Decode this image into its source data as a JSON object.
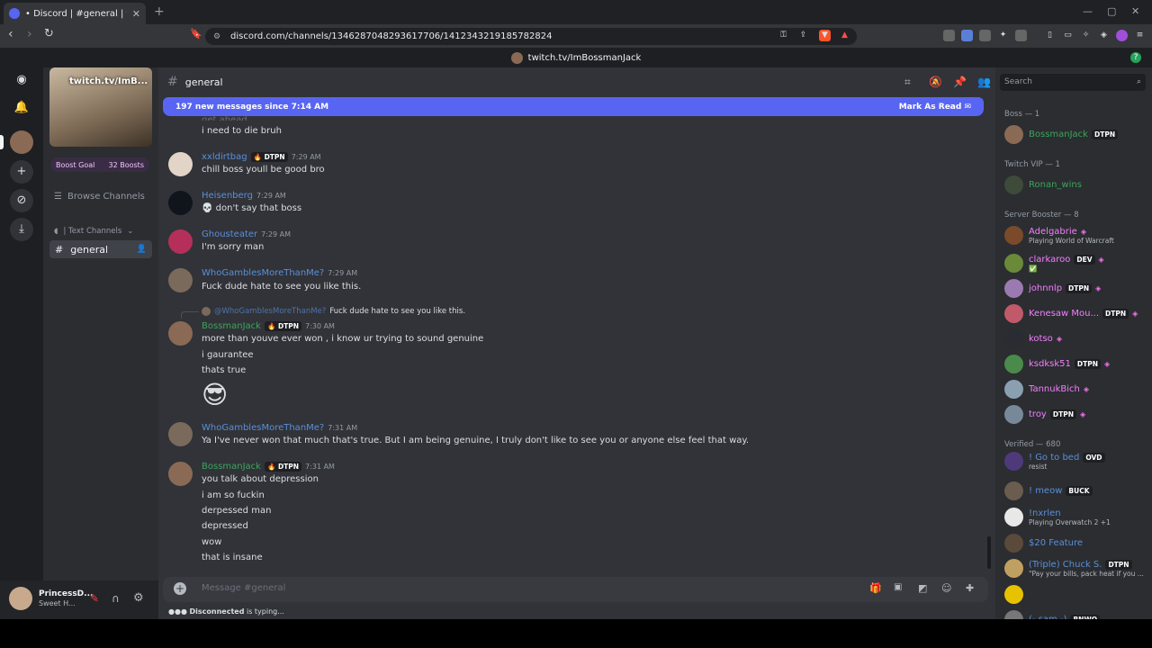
{
  "browser": {
    "tab_title": "• Discord | #general | twitch.tv/Im",
    "tab_close": "✕",
    "new_tab": "+",
    "url": "discord.com/channels/1346287048293617706/1412343219185782824"
  },
  "app": {
    "server_title": "twitch.tv/ImBossmanJack",
    "help": "?"
  },
  "sidebar": {
    "server_name": "twitch.tv/ImB...",
    "boost_goal": "Boost Goal",
    "boost_count": "32 Boosts",
    "browse_channels": "Browse Channels",
    "text_channels": "| Text Channels",
    "channel": "general"
  },
  "user_panel": {
    "name": "PrincessD...",
    "status": "Sweet H..."
  },
  "chat": {
    "channel_name": "general",
    "new_messages": "197 new messages since 7:14 AM",
    "mark_as_read": "Mark As Read",
    "partial_line": "get ahead",
    "composer_placeholder": "Message #general",
    "typing_user": "Disconnected",
    "typing_suffix": "is typing...",
    "messages": [
      {
        "lines": [
          "i need to die bruh"
        ]
      },
      {
        "user": "xxldirtbag",
        "badge": "DTPN",
        "time": "7:29 AM",
        "lines": [
          "chill boss youll be good bro"
        ]
      },
      {
        "user": "Heisenberg",
        "time": "7:29 AM",
        "lines": [
          "don't say that boss"
        ]
      },
      {
        "user": "Ghousteater",
        "time": "7:29 AM",
        "lines": [
          "I'm sorry man"
        ]
      },
      {
        "user": "WhoGamblesMoreThanMe?",
        "time": "7:29 AM",
        "lines": [
          "Fuck dude hate to see you like this."
        ]
      },
      {
        "reply_user": "@WhoGamblesMoreThanMe?",
        "reply_text": "Fuck dude hate to see you like this.",
        "user": "BossmanJack",
        "badge": "DTPN",
        "time": "7:30 AM",
        "lines": [
          "more than youve ever won , i know ur trying to sound genuine",
          "i gaurantee",
          "thats true"
        ],
        "emoji": "😎"
      },
      {
        "user": "WhoGamblesMoreThanMe?",
        "time": "7:31 AM",
        "lines": [
          "Ya I've never won that much that's true. But I am being genuine, I truly don't like to see you or anyone else feel that way."
        ]
      },
      {
        "user": "BossmanJack",
        "badge": "DTPN",
        "time": "7:31 AM",
        "lines": [
          "you talk about depression",
          "i am so fuckin",
          "derpessed man",
          "depressed",
          "wow",
          "that is insane"
        ]
      }
    ]
  },
  "members": {
    "search_placeholder": "Search",
    "groups": [
      {
        "label": "Boss — 1",
        "members": [
          {
            "name": "BossmanJack",
            "badge": "DTPN",
            "color": "#3ba55c"
          }
        ]
      },
      {
        "label": "Twitch VIP — 1",
        "members": [
          {
            "name": "Ronan_wins",
            "color": "#3ba55c"
          }
        ]
      },
      {
        "label": "Server Booster — 8",
        "members": [
          {
            "name": "Adelgabrie",
            "sub": "Playing World of Warcraft",
            "color": "#f47fff"
          },
          {
            "name": "clarkaroo",
            "badge": "DEV",
            "sub": "✅",
            "color": "#f47fff"
          },
          {
            "name": "johnnlp",
            "badge": "DTPN",
            "color": "#f47fff"
          },
          {
            "name": "Kenesaw Mou...",
            "badge": "DTPN",
            "color": "#f47fff"
          },
          {
            "name": "kotso",
            "color": "#f47fff"
          },
          {
            "name": "ksdksk51",
            "badge": "DTPN",
            "color": "#f47fff"
          },
          {
            "name": "TannukBich",
            "color": "#f47fff"
          },
          {
            "name": "troy",
            "badge": "DTPN",
            "color": "#f47fff"
          }
        ]
      },
      {
        "label": "Verified — 680",
        "members": [
          {
            "name": "! Go to bed",
            "badge": "OVD",
            "sub": "resist",
            "color": "#5b8fd9"
          },
          {
            "name": "! meow",
            "badge": "BUCK",
            "color": "#5b8fd9"
          },
          {
            "name": "!nxrlen",
            "sub": "Playing Overwatch 2 +1",
            "color": "#5b8fd9"
          },
          {
            "name": "$20 Feature",
            "color": "#5b8fd9"
          },
          {
            "name": "(Triple) Chuck S.",
            "badge": "DTPN",
            "sub": "\"Pay your bills, pack heat if you ...",
            "color": "#5b8fd9"
          },
          {
            "name": "",
            "color": "#5b8fd9"
          },
          {
            "name": "(- sam -)",
            "badge": "BNWO",
            "color": "#5b8fd9"
          }
        ]
      }
    ]
  },
  "colors": {
    "blurple": "#5865f2",
    "green": "#3ba55c",
    "link": "#5b8fd9",
    "booster": "#f47fff"
  }
}
